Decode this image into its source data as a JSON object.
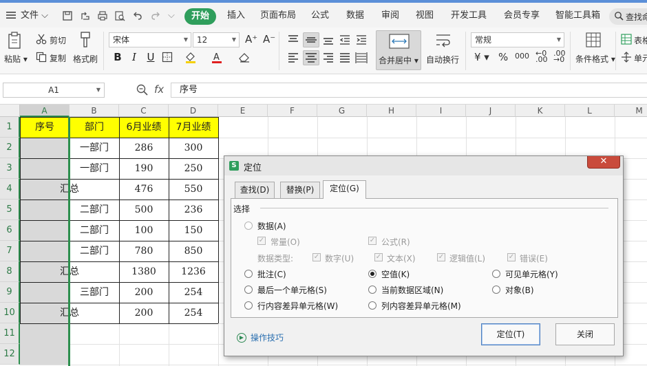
{
  "menubar": {
    "file_label": "文件",
    "tabs": [
      "开始",
      "插入",
      "页面布局",
      "公式",
      "数据",
      "审阅",
      "视图",
      "开发工具",
      "会员专享",
      "智能工具箱"
    ],
    "search_label": "查找命"
  },
  "ribbon": {
    "paste_label": "粘贴",
    "cut_label": "剪切",
    "copy_label": "复制",
    "format_painter_label": "格式刷",
    "font_name": "宋体",
    "font_size": "12",
    "merge_center_label": "合并居中",
    "wrap_text_label": "自动换行",
    "number_format": "常规",
    "conditional_format_label": "条件格式",
    "table_style_label": "表格",
    "cell_label": "单元",
    "percent_label": "%",
    "thousands_label": "000"
  },
  "formula_bar": {
    "name_box": "A1",
    "fx_label": "fx",
    "formula": "序号"
  },
  "grid": {
    "columns": [
      "A",
      "B",
      "C",
      "D",
      "E",
      "F",
      "G",
      "H",
      "I",
      "J",
      "K",
      "L",
      "M"
    ],
    "rows": [
      "1",
      "2",
      "3",
      "4",
      "5",
      "6",
      "7",
      "8",
      "9",
      "10",
      "11",
      "12"
    ],
    "header": [
      "序号",
      "部门",
      "6月业绩",
      "7月业绩"
    ],
    "data": [
      {
        "a": "",
        "b": "一部门",
        "c": "286",
        "d": "300"
      },
      {
        "a": "",
        "b": "一部门",
        "c": "190",
        "d": "250"
      },
      {
        "a": "汇总",
        "b": "",
        "c": "476",
        "d": "550"
      },
      {
        "a": "",
        "b": "二部门",
        "c": "500",
        "d": "236"
      },
      {
        "a": "",
        "b": "二部门",
        "c": "100",
        "d": "150"
      },
      {
        "a": "",
        "b": "二部门",
        "c": "780",
        "d": "850"
      },
      {
        "a": "汇总",
        "b": "",
        "c": "1380",
        "d": "1236"
      },
      {
        "a": "",
        "b": "三部门",
        "c": "200",
        "d": "254"
      },
      {
        "a": "汇总",
        "b": "",
        "c": "200",
        "d": "254"
      }
    ]
  },
  "dialog": {
    "title": "定位",
    "close_label": "✕",
    "tabs": [
      "查找(D)",
      "替换(P)",
      "定位(G)"
    ],
    "group_label": "选择",
    "options": {
      "data": "数据(A)",
      "constant": "常量(O)",
      "formula": "公式(R)",
      "data_type_label": "数据类型:",
      "number": "数字(U)",
      "text": "文本(X)",
      "logical": "逻辑值(L)",
      "error": "错误(E)",
      "comment": "批注(C)",
      "blank": "空值(K)",
      "visible_cells": "可见单元格(Y)",
      "last_cell": "最后一个单元格(S)",
      "current_region": "当前数据区域(N)",
      "objects": "对象(B)",
      "row_diff": "行内容差异单元格(W)",
      "col_diff": "列内容差异单元格(M)"
    },
    "selected_option": "blank",
    "help_label": "操作技巧",
    "ok_label": "定位(T)",
    "close_btn_label": "关闭"
  }
}
